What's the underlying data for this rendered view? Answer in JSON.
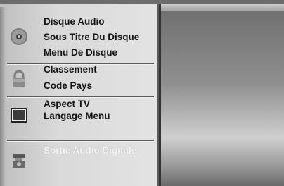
{
  "menu": {
    "groups": [
      {
        "icon": "disc-icon",
        "items": [
          "Disque Audio",
          "Sous Titre Du Disque",
          "Menu De Disque"
        ]
      },
      {
        "icon": "padlock-icon",
        "items": [
          "Classement",
          "Code Pays"
        ]
      },
      {
        "icon": "tv-screen-icon",
        "items": [
          "Aspect TV",
          "Langage Menu"
        ]
      },
      {
        "icon": "speaker-audio-icon",
        "items": [
          "Sortie Audio Digitale"
        ],
        "state": "disabled"
      }
    ]
  },
  "colors": {
    "panel": "#d9d9d9",
    "text": "#141414",
    "disabled_text": "#f4f4f4",
    "divider": "#5a5a5a"
  }
}
